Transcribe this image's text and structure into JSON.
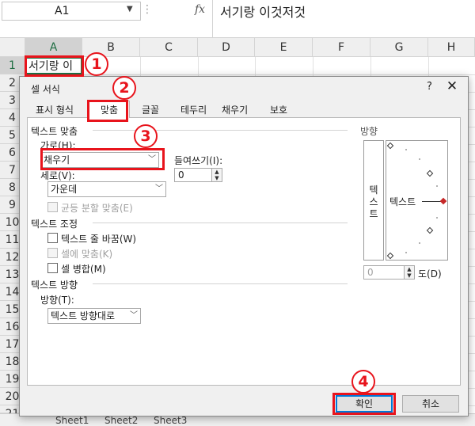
{
  "excel": {
    "name_box": "A1",
    "fx_label": "fx",
    "formula_value": "서기랑 이것저것",
    "cell_a1_text": "서기랑 이",
    "columns": [
      "A",
      "B",
      "C",
      "D",
      "E",
      "F",
      "G",
      "H"
    ],
    "rows": [
      "1",
      "2",
      "3",
      "4",
      "5",
      "6",
      "7",
      "8",
      "9",
      "10",
      "11",
      "12",
      "13",
      "14",
      "15",
      "16",
      "17",
      "18",
      "19",
      "20",
      "21"
    ],
    "sheet_tabs": [
      "Sheet1",
      "Sheet2",
      "Sheet3"
    ]
  },
  "dialog": {
    "title": "셀 서식",
    "help": "?",
    "close": "✕",
    "tabs": [
      "표시 형식",
      "맞춤",
      "글꼴",
      "테두리",
      "채우기",
      "보호"
    ],
    "active_tab": "맞춤",
    "text_alignment": {
      "section_title": "텍스트 맞춤",
      "horizontal_label": "가로(H):",
      "horizontal_value": "채우기",
      "indent_label": "들여쓰기(I):",
      "indent_value": "0",
      "vertical_label": "세로(V):",
      "vertical_value": "가운데",
      "distributed_label": "균등 분할 맞춤(E)"
    },
    "text_control": {
      "section_title": "텍스트 조정",
      "wrap_label": "텍스트 줄 바꿈(W)",
      "shrink_label": "셀에 맞춤(K)",
      "merge_label": "셀 병합(M)"
    },
    "direction": {
      "section_title": "텍스트 방향",
      "label": "방향(T):",
      "value": "텍스트 방향대로"
    },
    "orientation": {
      "title": "방향",
      "vertical_text": "텍\n스\n트",
      "horizontal_text": "텍스트",
      "degrees_value": "0",
      "degrees_label": "도(D)"
    },
    "buttons": {
      "ok": "확인",
      "cancel": "취소"
    }
  },
  "annotations": [
    "1",
    "2",
    "3",
    "4"
  ],
  "colors": {
    "annotation_red": "#e8141c",
    "excel_green": "#217346",
    "focus_blue": "#0078d7"
  }
}
